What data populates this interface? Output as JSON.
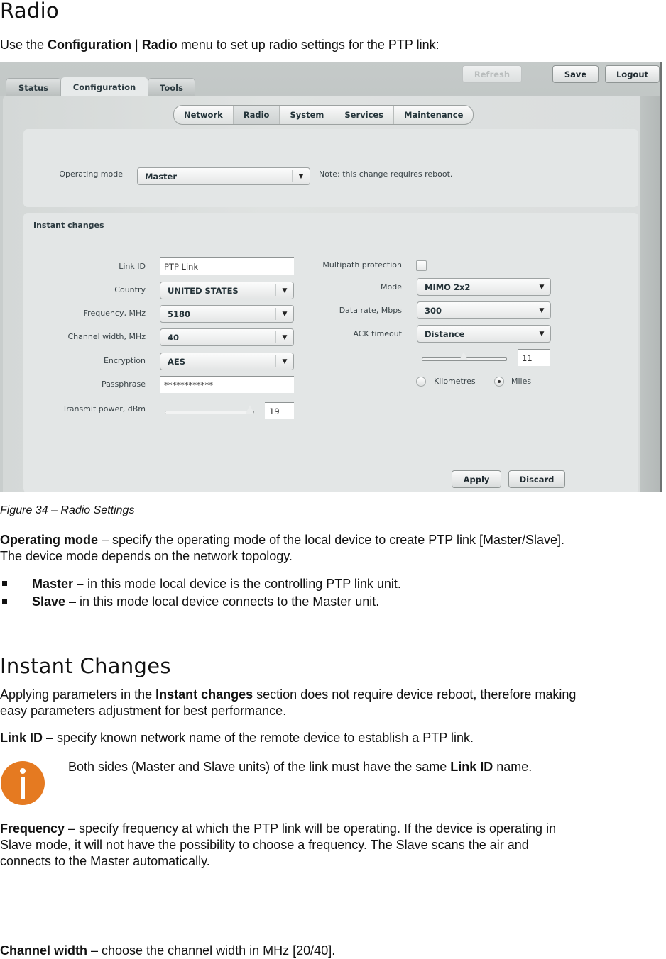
{
  "doc": {
    "heading": "Radio",
    "intro": {
      "pre": "Use the ",
      "b1": "Configuration",
      "sep": " | ",
      "b2": "Radio",
      "post": " menu to set up radio settings for the PTP link:"
    },
    "caption": "Figure 34 – Radio Settings",
    "operating_mode_para": {
      "b": "Operating mode",
      "t1": " – specify the operating mode of the local device to create PTP link [Master/Slave].",
      "t2": "The device mode depends on the network topology."
    },
    "bullets": [
      {
        "b": "Master –",
        "t": " in this mode local device is the controlling PTP link unit."
      },
      {
        "b": "Slave",
        "t": " – in this mode local device connects to the Master unit."
      }
    ],
    "heading2": "Instant Changes",
    "instant_para": {
      "pre": "Applying parameters in the ",
      "b": "Instant changes",
      "post": " section does not require device reboot, therefore making",
      "line2": "easy parameters adjustment for best performance."
    },
    "linkid_para": {
      "b": "Link ID",
      "t": " – specify known network name of the remote device to establish a PTP link."
    },
    "note": {
      "icon": "info-icon",
      "pre": "Both sides (Master and Slave units) of the link must have the same ",
      "b": "Link ID",
      "post": " name."
    },
    "frequency_para": {
      "b": "Frequency",
      "t1": " – specify frequency at which the PTP link will be operating. If the device is operating in",
      "t2": "Slave mode, it will not have the possibility to choose a frequency. The Slave scans the air and",
      "t3": "connects to the Master automatically."
    },
    "channel_para": {
      "b": "Channel width",
      "t": " – choose the channel width in MHz [20/40]."
    }
  },
  "ui": {
    "main_tabs": [
      {
        "label": "Status",
        "active": false
      },
      {
        "label": "Configuration",
        "active": true
      },
      {
        "label": "Tools",
        "active": false
      }
    ],
    "top_buttons": {
      "refresh": "Refresh",
      "save": "Save",
      "logout": "Logout"
    },
    "sub_tabs": [
      {
        "label": "Network",
        "active": false
      },
      {
        "label": "Radio",
        "active": true
      },
      {
        "label": "System",
        "active": false
      },
      {
        "label": "Services",
        "active": false
      },
      {
        "label": "Maintenance",
        "active": false
      }
    ],
    "operating_mode": {
      "label": "Operating mode",
      "value": "Master",
      "note": "Note: this change requires reboot."
    },
    "instant_title": "Instant changes",
    "fields": {
      "link_id": {
        "label": "Link ID",
        "value": "PTP Link"
      },
      "country": {
        "label": "Country",
        "value": "UNITED STATES"
      },
      "frequency": {
        "label": "Frequency, MHz",
        "value": "5180"
      },
      "channel_width": {
        "label": "Channel width, MHz",
        "value": "40"
      },
      "encryption": {
        "label": "Encryption",
        "value": "AES"
      },
      "passphrase": {
        "label": "Passphrase",
        "value": "************"
      },
      "tx_power": {
        "label": "Transmit power, dBm",
        "value": "19",
        "slider_fraction": 0.97
      },
      "multipath": {
        "label": "Multipath protection",
        "checked": false
      },
      "mode": {
        "label": "Mode",
        "value": "MIMO 2x2"
      },
      "data_rate": {
        "label": "Data rate, Mbps",
        "value": "300"
      },
      "ack_timeout": {
        "label": "ACK timeout",
        "value": "Distance"
      },
      "distance": {
        "value": "11",
        "slider_fraction": 0.5
      },
      "units": {
        "km": "Kilometres",
        "miles": "Miles",
        "selected": "miles"
      }
    },
    "buttons": {
      "apply": "Apply",
      "discard": "Discard"
    },
    "arrow_glyph": "▼"
  }
}
